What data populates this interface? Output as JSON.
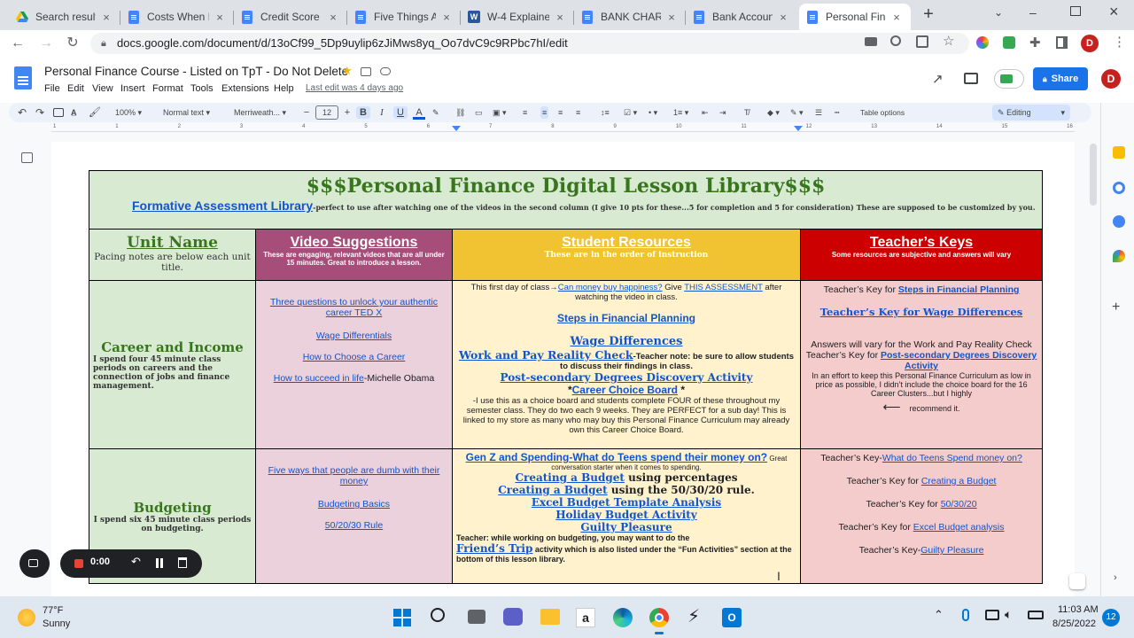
{
  "browser": {
    "tabs": [
      {
        "title": "Search result",
        "icon": "google-drive-icon",
        "active": false
      },
      {
        "title": "Costs When E",
        "icon": "docs-icon",
        "active": false
      },
      {
        "title": "Credit Score F",
        "icon": "docs-icon",
        "active": false
      },
      {
        "title": "Five Things A",
        "icon": "docs-icon",
        "active": false
      },
      {
        "title": "W-4 Explaine",
        "icon": "word-icon",
        "active": false
      },
      {
        "title": "BANK CHARG",
        "icon": "docs-icon",
        "active": false
      },
      {
        "title": "Bank Accoun",
        "icon": "docs-icon",
        "active": false
      },
      {
        "title": "Personal Fina",
        "icon": "docs-icon",
        "active": true
      }
    ],
    "close_glyph": "×",
    "new_tab": "+",
    "url": "docs.google.com/document/d/13oCf99_5Dp9uylip6zJiMws8yq_Oo7dvC9c9RPbc7hI/edit"
  },
  "docs": {
    "title": "Personal Finance Course - Listed on TpT - Do Not Delete",
    "menus": [
      "File",
      "Edit",
      "View",
      "Insert",
      "Format",
      "Tools",
      "Extensions",
      "Help"
    ],
    "last_edit": "Last edit was 4 days ago",
    "share_label": "Share",
    "avatar_letter": "D"
  },
  "toolbar": {
    "zoom": "100%",
    "style": "Normal text",
    "font": "Merriweath...",
    "font_size": "12",
    "table_options": "Table options",
    "mode": "Editing",
    "bold": "B",
    "italic": "I",
    "underline": "U",
    "text_color": "A",
    "minus": "−",
    "plus": "+"
  },
  "ruler": {
    "ticks": [
      "1",
      "1",
      "2",
      "3",
      "4",
      "5",
      "6",
      "7",
      "8",
      "9",
      "10",
      "11",
      "12",
      "13",
      "14",
      "15",
      "16"
    ]
  },
  "table": {
    "banner_title": "$$$Personal Finance Digital Lesson Library$$$",
    "banner_link": "Formative Assessment Library",
    "banner_note": "-perfect to use after watching one of the videos in the second column (I give 10 pts for these...5 for completion and 5 for consideration) These are supposed to be customized by you.",
    "headers": [
      {
        "title": "Unit Name",
        "sub": "Pacing notes are below each unit title."
      },
      {
        "title": "Video Suggestions",
        "sub": "These are engaging, relevant videos that are all under 15 minutes. Great to introduce a lesson."
      },
      {
        "title": "Student Resources",
        "sub": "These are in the order of instruction"
      },
      {
        "title": "Teacher’s Keys",
        "sub": "Some resources are subjective and answers will vary"
      }
    ],
    "career": {
      "unit": "Career and Income",
      "pacing": "I spend four 45 minute class periods on careers and the connection of jobs and finance management.",
      "videos": [
        {
          "link": "Three questions to unlock your authentic career TED X",
          "suffix": ""
        },
        {
          "link": "Wage Differentials",
          "suffix": ""
        },
        {
          "link": "How to Choose a Career",
          "suffix": ""
        },
        {
          "link": "How to succeed in life",
          "suffix": "-Michelle Obama"
        }
      ],
      "student": {
        "intro_pre": "This first day of class→",
        "intro_link1": "Can money buy happiness?",
        "intro_mid": " Give ",
        "intro_link2": "THIS ASSESSMENT",
        "intro_post": " after watching the video in class.",
        "steps": "Steps in Financial Planning",
        "wage": "Wage Differences",
        "reality": "Work and Pay Reality Check",
        "reality_note": "-Teacher note: be sure to allow students to discuss their findings in class.",
        "postsec": "Post-secondary Degrees Discovery Activity",
        "choice_pre": "*",
        "choice": "Career Choice Board",
        "choice_post": " *",
        "choice_note": "-I use this as a choice board and students complete FOUR of these throughout my semester class. They do two each 9 weeks. They are PERFECT for a sub day! This is linked to my store as many who may buy this Personal Finance Curriculum may already own this Career Choice Board."
      },
      "keys": {
        "k1_pre": "Teacher’s Key for ",
        "k1_link": "Steps in Financial Planning",
        "k2_link": "Teacher’s Key for Wage Differences",
        "k3": "Answers will vary for the Work and Pay Reality Check",
        "k4_pre": "Teacher’s Key for ",
        "k4_link": "Post-secondary Degrees Discovery Activity",
        "k5": "In an effort to keep this Personal Finance Curriculum as low in price as possible, I didn’t include the choice board for the 16 Career Clusters...but I highly",
        "k5_arrow": "⟵",
        "k5_end": "recommend it."
      }
    },
    "budget": {
      "unit": "Budgeting",
      "pacing": "I spend six 45 minute class periods on budgeting.",
      "videos": [
        "Five ways that people are dumb with their money",
        "Budgeting Basics",
        "50/20/30 Rule"
      ],
      "student": {
        "genz": "Gen Z and Spending-What do Teens spend their money on?",
        "genz_note": " Great conversation starter when it comes to spending.",
        "cab1": "Creating a Budget",
        "cab1_post": " using percentages",
        "cab2": "Creating a Budget",
        "cab2_post": " using the 50/30/20 rule.",
        "excel": "Excel Budget Template Analysis",
        "holiday": "Holiday Budget Activity",
        "guilty": "Guilty Pleasure",
        "teacher_note": "Teacher: while working on budgeting, you may want to do the",
        "friend": "Friend’s Trip",
        "friend_post": " activity which is also listed under the “Fun Activities” section at the bottom of this lesson library."
      },
      "keys": {
        "b1_pre": "Teacher’s Key-",
        "b1_link": "What do Teens Spend money on?",
        "b2_pre": "Teacher’s Key for ",
        "b2_link": "Creating a Budget",
        "b3_pre": "Teacher’s Key for ",
        "b3_link": "50/30/20",
        "b4_pre": "Teacher’s Key for ",
        "b4_link": "Excel Budget analysis",
        "b5_pre": "Teacher’s Key-",
        "b5_link": "Guilty Pleasure"
      }
    }
  },
  "recorder": {
    "time": "0:00"
  },
  "taskbar": {
    "temp": "77°F",
    "weather": "Sunny",
    "time": "11:03 AM",
    "date": "8/25/2022",
    "badge": "12"
  },
  "colors": {
    "banner_bg": "#d9ead3",
    "unit_bg": "#d9ead3",
    "video_bg": "#ead1dc",
    "video_head": "#a64d79",
    "student_bg": "#fff2cc",
    "student_head": "#f1c232",
    "key_bg": "#f4cccc",
    "key_head": "#cc0000",
    "green_text": "#38761d",
    "link": "#1155cc"
  }
}
